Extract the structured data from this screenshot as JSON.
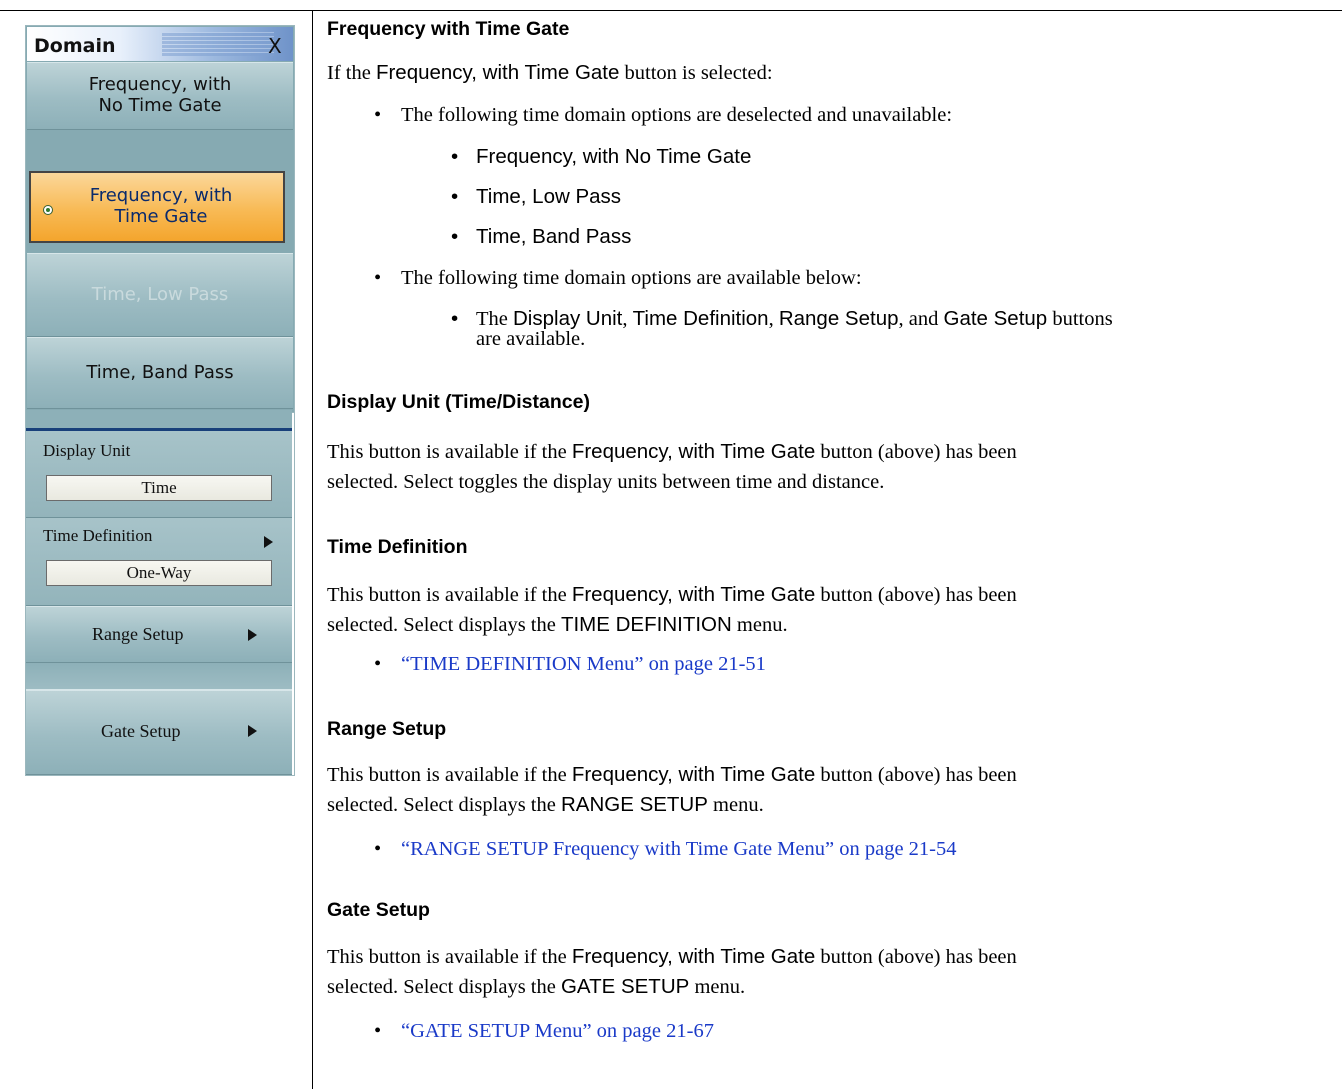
{
  "menu": {
    "title": "Domain",
    "close_label": "X",
    "buttons": {
      "freq_no_gate_line1": "Frequency, with",
      "freq_no_gate_line2": "No Time Gate",
      "freq_gate_line1": "Frequency, with",
      "freq_gate_line2": "Time Gate",
      "time_low_pass": "Time, Low Pass",
      "time_band_pass": "Time, Band Pass",
      "display_unit_label": "Display Unit",
      "display_unit_value": "Time",
      "time_definition_label": "Time Definition",
      "time_definition_value": "One-Way",
      "range_setup": "Range Setup",
      "gate_setup": "Gate Setup"
    },
    "selected": "Frequency, with Time Gate",
    "disabled": [
      "Time, Low Pass"
    ]
  },
  "doc": {
    "s1": {
      "heading": "Frequency with Time Gate",
      "intro_pre": "If the ",
      "intro_btn": "Frequency, with Time Gate",
      "intro_post": " button is selected:",
      "bullet1": "The following time domain options are deselected and unavailable:",
      "sub1": [
        "Frequency, with No Time Gate",
        "Time, Low Pass",
        "Time, Band Pass"
      ],
      "bullet2": "The following time domain options are available below:",
      "sub2_pre": "The ",
      "sub2_b1": "Display Unit",
      "sub2_sep1": ", ",
      "sub2_b2": "Time Definition",
      "sub2_sep2": ", ",
      "sub2_b3": "Range Setup",
      "sub2_sep3": ", and ",
      "sub2_b4": "Gate Setup",
      "sub2_post": " buttons",
      "sub2_line2": "are available."
    },
    "s2": {
      "heading": "Display Unit (Time/Distance)",
      "l1_pre": "This button is available if the ",
      "l1_btn": "Frequency, with Time Gate",
      "l1_post": " button (above) has been",
      "l2": "selected. Select toggles the display units between time and distance."
    },
    "s3": {
      "heading": "Time Definition",
      "l1_pre": "This button is available if the ",
      "l1_btn": "Frequency, with Time Gate",
      "l1_post": " button (above) has been",
      "l2_pre": "selected. Select displays the ",
      "l2_menu": "TIME DEFINITION",
      "l2_post": " menu.",
      "link": "“TIME DEFINITION Menu” on page 21-51"
    },
    "s4": {
      "heading": "Range Setup",
      "l1_pre": "This button is available if the ",
      "l1_btn": "Frequency, with Time Gate",
      "l1_post": " button (above) has been",
      "l2_pre": "selected. Select displays the ",
      "l2_menu": "RANGE SETUP",
      "l2_post": " menu.",
      "link": "“RANGE SETUP Frequency with Time Gate Menu” on page 21-54"
    },
    "s5": {
      "heading": "Gate Setup",
      "l1_pre": "This button is available if the ",
      "l1_btn": "Frequency, with Time Gate",
      "l1_post": " button (above) has been",
      "l2_pre": "selected. Select displays the ",
      "l2_menu": "GATE SETUP",
      "l2_post": " menu.",
      "link": "“GATE SETUP Menu” on page 21-67"
    },
    "bullet_char": "•"
  }
}
